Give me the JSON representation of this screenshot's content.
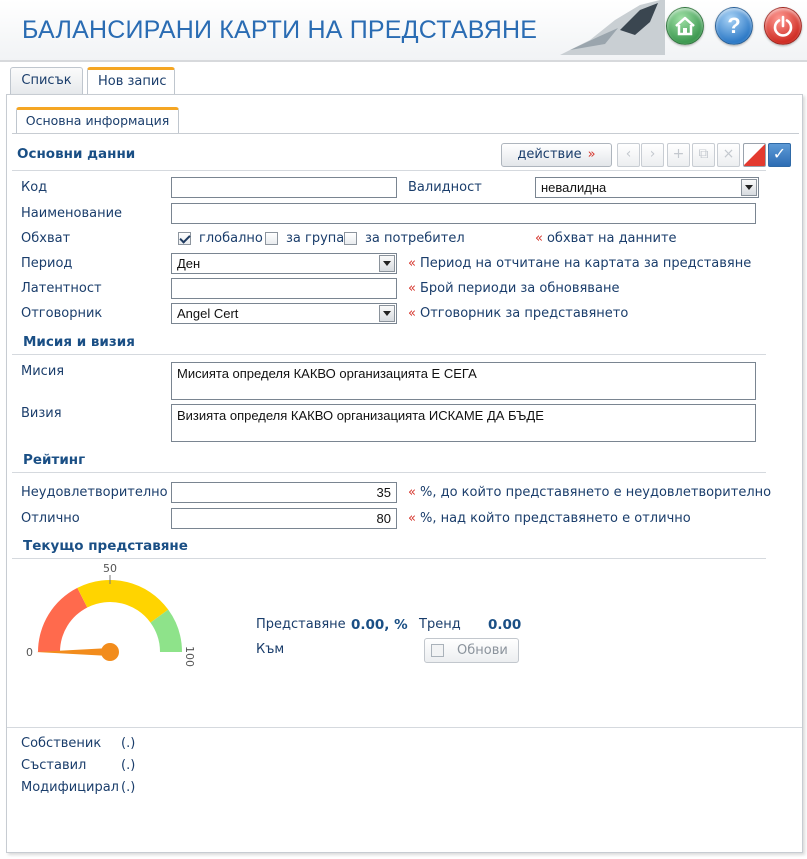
{
  "header": {
    "title": "БАЛАНСИРАНИ КАРТИ НА ПРЕДСТАВЯНЕ",
    "buttons": [
      {
        "name": "home",
        "icon": "home-icon"
      },
      {
        "name": "help",
        "icon": "help-icon",
        "label": "?"
      },
      {
        "name": "power",
        "icon": "power-icon"
      }
    ]
  },
  "tabs": [
    {
      "label": "Списък",
      "active": false
    },
    {
      "label": "Нов запис",
      "active": true
    }
  ],
  "subtab": {
    "label": "Основна информация"
  },
  "sections": {
    "main": "Основни данни",
    "mission": "Мисия и визия",
    "rating": "Рейтинг",
    "current": "Текущо представяне"
  },
  "toolbar": {
    "action_label": "действие",
    "action_arrow": "»",
    "icons": [
      "prev-icon",
      "next-icon",
      "add-icon",
      "copy-icon",
      "delete-icon",
      "cancel-icon",
      "save-icon"
    ]
  },
  "form": {
    "code": {
      "label": "Код",
      "value": ""
    },
    "validity": {
      "label": "Валидност",
      "value": "невалидна"
    },
    "name": {
      "label": "Наименование",
      "value": ""
    },
    "scope": {
      "label": "Обхват",
      "options": [
        {
          "label": "глобално",
          "checked": true
        },
        {
          "label": "за група",
          "checked": false
        },
        {
          "label": "за потребител",
          "checked": false
        }
      ],
      "hint": "обхват на данните"
    },
    "period": {
      "label": "Период",
      "value": "Ден",
      "hint": "Период на отчитане на картата за представяне"
    },
    "latency": {
      "label": "Латентност",
      "value": "",
      "hint": "Брой периоди за обновяване"
    },
    "owner": {
      "label": "Отговорник",
      "value": "Angel Cert",
      "hint": "Отговорник за представянето"
    },
    "mission": {
      "label": "Мисия",
      "value": "Мисията определя КАКВО организацията Е СЕГА"
    },
    "vision": {
      "label": "Визия",
      "value": "Визията определя КАКВО организацията ИСКАМЕ ДА БЪДЕ"
    },
    "unsatisfactory": {
      "label": "Неудовлетворително",
      "value": "35",
      "hint": "%, до който представянето е неудовлетворително"
    },
    "excellent": {
      "label": "Отлично",
      "value": "80",
      "hint": "%, над който представянето е отлично"
    }
  },
  "hint_arrow": "«",
  "gauge": {
    "min": 0,
    "mid": 50,
    "max": 100,
    "min_label": "0",
    "mid_label": "50",
    "max_label": "100",
    "value": 0,
    "bands": [
      {
        "from": 0,
        "to": 35,
        "color": "#ff6a4d"
      },
      {
        "from": 35,
        "to": 80,
        "color": "#ffd400"
      },
      {
        "from": 80,
        "to": 100,
        "color": "#8ee38a"
      }
    ],
    "needle_color": "#f28c1c"
  },
  "performance": {
    "label": "Представяне",
    "value": "0.00, %",
    "trend_label": "Тренд",
    "trend_value": "0.00",
    "to_label": "Към",
    "refresh_label": "Обнови"
  },
  "footer": {
    "owner_label": "Собственик",
    "owner_value": "(.)",
    "author_label": "Съставил",
    "author_value": "(.)",
    "modified_label": "Модифицирал",
    "modified_value": "(.)"
  }
}
